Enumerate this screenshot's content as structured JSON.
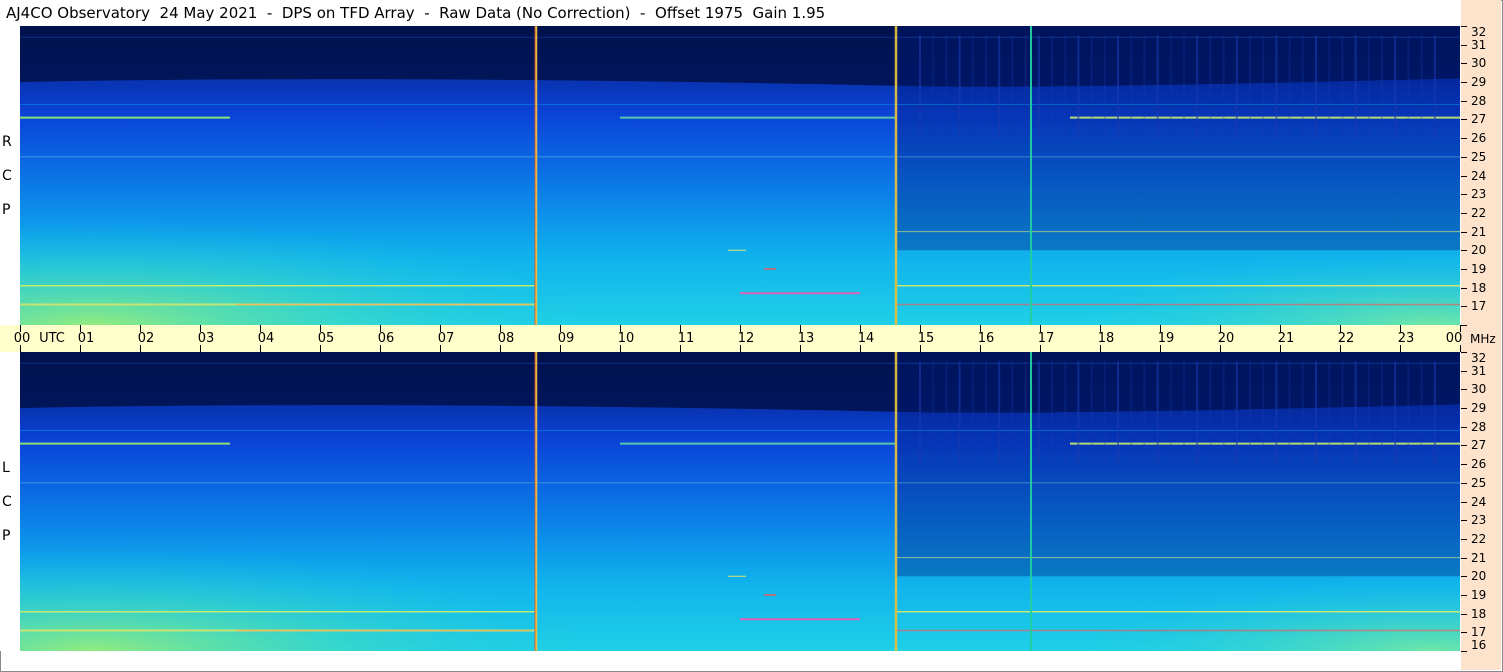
{
  "title": "AJ4CO Observatory  24 May 2021  -  DPS on TFD Array  -  Raw Data (No Correction)  -  Offset 1975  Gain 1.95",
  "panels": [
    {
      "pol": [
        "R",
        "C",
        "P"
      ]
    },
    {
      "pol": [
        "L",
        "C",
        "P"
      ]
    }
  ],
  "time_axis": {
    "labels": [
      "00",
      "UTC",
      "01",
      "02",
      "03",
      "04",
      "05",
      "06",
      "07",
      "08",
      "09",
      "10",
      "11",
      "12",
      "13",
      "14",
      "15",
      "16",
      "17",
      "18",
      "19",
      "20",
      "21",
      "22",
      "23",
      "00"
    ],
    "unit_right": "MHz"
  },
  "freq_axis": {
    "labels": [
      "32",
      "31",
      "30",
      "29",
      "28",
      "27",
      "26",
      "25",
      "24",
      "23",
      "22",
      "21",
      "20",
      "19",
      "18",
      "17",
      "16"
    ]
  },
  "colors": {
    "timeaxis_bg": "#ffffcc",
    "freq_bg": "#fde3cb"
  },
  "chart_data": {
    "type": "heatmap",
    "title": "AJ4CO Observatory  24 May 2021  -  DPS on TFD Array  -  Raw Data (No Correction)  -  Offset 1975  Gain 1.95",
    "x": {
      "label": "UTC",
      "range": [
        "00",
        "00"
      ],
      "ticks": [
        "00",
        "01",
        "02",
        "03",
        "04",
        "05",
        "06",
        "07",
        "08",
        "09",
        "10",
        "11",
        "12",
        "13",
        "14",
        "15",
        "16",
        "17",
        "18",
        "19",
        "20",
        "21",
        "22",
        "23",
        "00"
      ]
    },
    "y": {
      "label": "MHz",
      "range": [
        16,
        32
      ],
      "ticks": [
        32,
        31,
        30,
        29,
        28,
        27,
        26,
        25,
        24,
        23,
        22,
        21,
        20,
        19,
        18,
        17,
        16
      ]
    },
    "panels": [
      "RCP",
      "LCP"
    ],
    "vertical_marker_times_utc": [
      8.6,
      14.6,
      16.85
    ],
    "strong_bands_mhz": [
      27.1,
      18.1,
      17.1
    ]
  }
}
